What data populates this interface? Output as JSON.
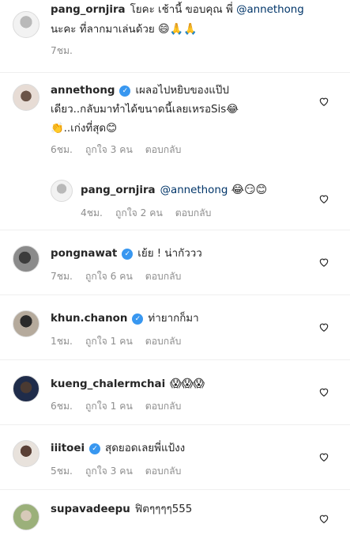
{
  "top_comment": {
    "username": "pang_ornjira",
    "text1": "โยคะ เช้านี้ ขอบคุณ พี่ ",
    "mention": "@annethong",
    "text2": "นะคะ ที่ลากมาเล่นด้วย",
    "emoji": "😄🙏🙏",
    "time": "7ชม."
  },
  "comments": [
    {
      "username": "annethong",
      "verified": true,
      "line1": "เผลอไปหยิบของแป๊ป",
      "line2": "เดียว..กลับมาทำได้ขนาดนี้เลยเหรอSis😂",
      "line3": "👏..เก่งที่สุด😊",
      "time": "6ชม.",
      "likes": "ถูกใจ 3 คน",
      "reply": "ตอบกลับ"
    },
    {
      "username": "pang_ornjira",
      "mention": "@annethong",
      "emoji": "😂😏😊",
      "time": "4ชม.",
      "likes": "ถูกใจ 2 คน",
      "reply": "ตอบกลับ"
    },
    {
      "username": "pongnawat",
      "verified": true,
      "text": "เย้ย ! น่ากัววว",
      "time": "7ชม.",
      "likes": "ถูกใจ 6 คน",
      "reply": "ตอบกลับ"
    },
    {
      "username": "khun.chanon",
      "verified": true,
      "text": "ท่ายากก็มา",
      "time": "1ชม.",
      "likes": "ถูกใจ 1 คน",
      "reply": "ตอบกลับ"
    },
    {
      "username": "kueng_chalermchai",
      "text": "😱😱😱",
      "time": "6ชม.",
      "likes": "ถูกใจ 1 คน",
      "reply": "ตอบกลับ"
    },
    {
      "username": "iiitoei",
      "verified": true,
      "text": "สุดยอดเลยพี่แป้งง",
      "time": "5ชม.",
      "likes": "ถูกใจ 3 คน",
      "reply": "ตอบกลับ"
    },
    {
      "username": "supavadeepu",
      "text": "ฟิตๆๆๆๆ555",
      "time": "",
      "likes": "",
      "reply": ""
    }
  ],
  "icons": {
    "heart": "heart-outline-icon",
    "verified": "verified-badge-icon"
  }
}
